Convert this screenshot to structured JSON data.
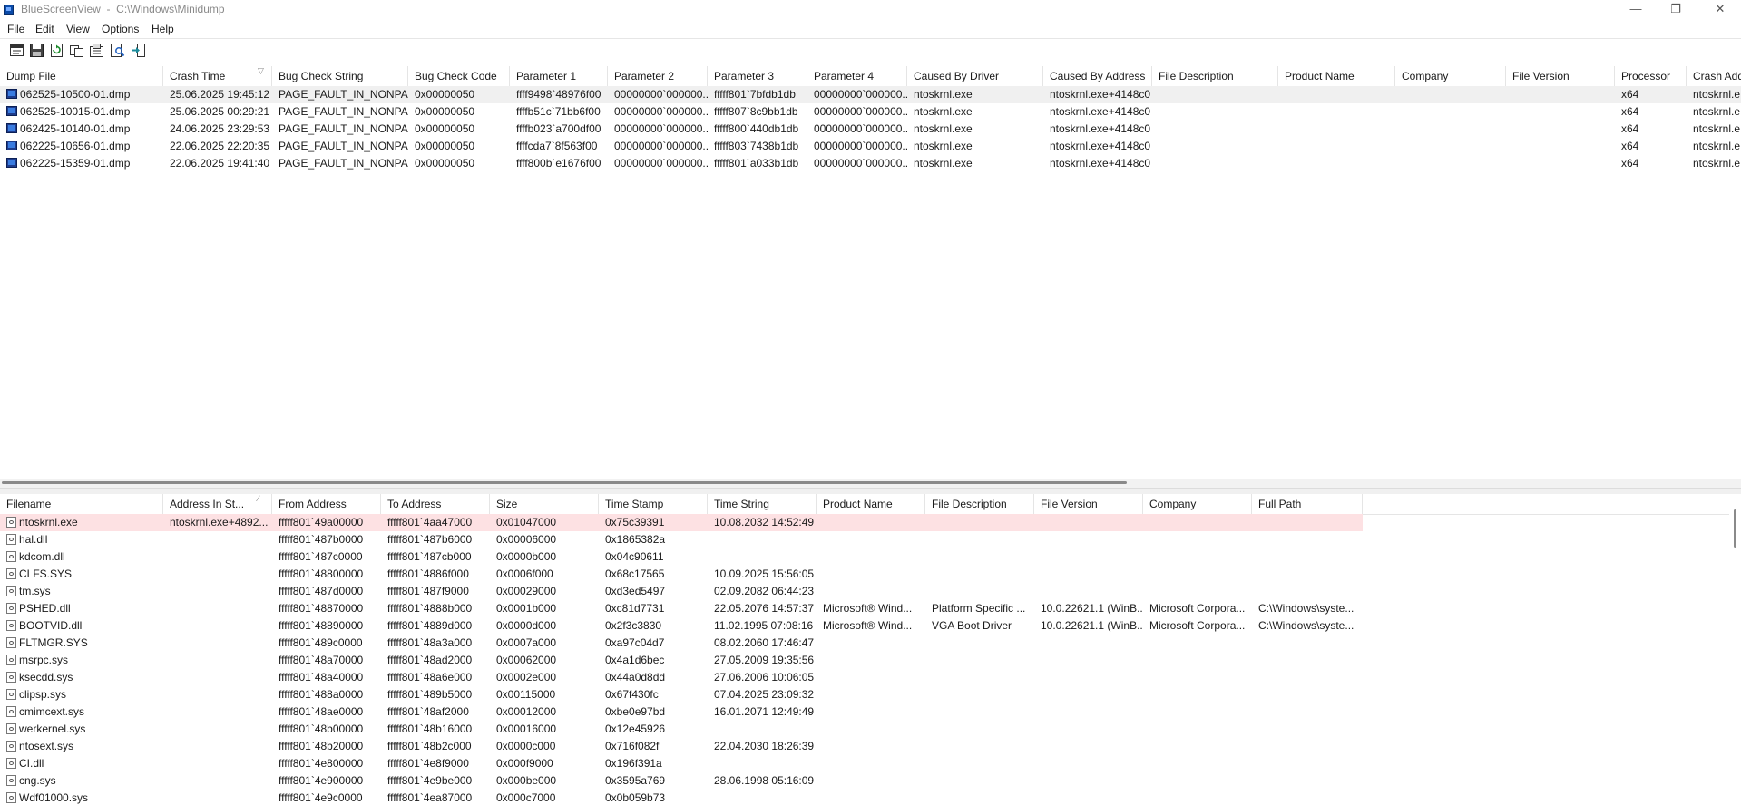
{
  "window": {
    "title": "BlueScreenView  -  C:\\Windows\\Minidump",
    "min_icon": "minimize-icon",
    "max_icon": "maximize-icon",
    "close_icon": "close-icon"
  },
  "menu": [
    "File",
    "Edit",
    "View",
    "Options",
    "Help"
  ],
  "toolbar": {
    "buttons": [
      "html-report-icon",
      "save-icon",
      "refresh-icon",
      "copy-icon",
      "properties-icon",
      "find-icon",
      "exit-icon"
    ]
  },
  "crashes": {
    "columns": [
      "Dump File",
      "Crash Time",
      "Bug Check String",
      "Bug Check Code",
      "Parameter 1",
      "Parameter 2",
      "Parameter 3",
      "Parameter 4",
      "Caused By Driver",
      "Caused By Address",
      "File Description",
      "Product Name",
      "Company",
      "File Version",
      "Processor",
      "Crash Add"
    ],
    "sort_column": "Crash Time",
    "rows": [
      [
        "062525-10500-01.dmp",
        "25.06.2025 19:45:12",
        "PAGE_FAULT_IN_NONPA...",
        "0x00000050",
        "ffff9498`48976f00",
        "00000000`000000...",
        "fffff801`7bfdb1db",
        "00000000`000000...",
        "ntoskrnl.exe",
        "ntoskrnl.exe+4148c0",
        "",
        "",
        "",
        "",
        "x64",
        "ntoskrnl.e"
      ],
      [
        "062525-10015-01.dmp",
        "25.06.2025 00:29:21",
        "PAGE_FAULT_IN_NONPA...",
        "0x00000050",
        "ffffb51c`71bb6f00",
        "00000000`000000...",
        "fffff807`8c9bb1db",
        "00000000`000000...",
        "ntoskrnl.exe",
        "ntoskrnl.exe+4148c0",
        "",
        "",
        "",
        "",
        "x64",
        "ntoskrnl.e"
      ],
      [
        "062425-10140-01.dmp",
        "24.06.2025 23:29:53",
        "PAGE_FAULT_IN_NONPA...",
        "0x00000050",
        "ffffb023`a700df00",
        "00000000`000000...",
        "fffff800`440db1db",
        "00000000`000000...",
        "ntoskrnl.exe",
        "ntoskrnl.exe+4148c0",
        "",
        "",
        "",
        "",
        "x64",
        "ntoskrnl.e"
      ],
      [
        "062225-10656-01.dmp",
        "22.06.2025 22:20:35",
        "PAGE_FAULT_IN_NONPA...",
        "0x00000050",
        "ffffcda7`8f563f00",
        "00000000`000000...",
        "fffff803`7438b1db",
        "00000000`000000...",
        "ntoskrnl.exe",
        "ntoskrnl.exe+4148c0",
        "",
        "",
        "",
        "",
        "x64",
        "ntoskrnl.e"
      ],
      [
        "062225-15359-01.dmp",
        "22.06.2025 19:41:40",
        "PAGE_FAULT_IN_NONPA...",
        "0x00000050",
        "ffff800b`e1676f00",
        "00000000`000000...",
        "fffff801`a033b1db",
        "00000000`000000...",
        "ntoskrnl.exe",
        "ntoskrnl.exe+4148c0",
        "",
        "",
        "",
        "",
        "x64",
        "ntoskrnl.e"
      ]
    ]
  },
  "drivers": {
    "columns": [
      "Filename",
      "Address In St...",
      "From Address",
      "To Address",
      "Size",
      "Time Stamp",
      "Time String",
      "Product Name",
      "File Description",
      "File Version",
      "Company",
      "Full Path"
    ],
    "sort_column": "Address In St...",
    "rows": [
      [
        "ntoskrnl.exe",
        "ntoskrnl.exe+4892...",
        "fffff801`49a00000",
        "fffff801`4aa47000",
        "0x01047000",
        "0x75c39391",
        "10.08.2032 14:52:49",
        "",
        "",
        "",
        "",
        ""
      ],
      [
        "hal.dll",
        "",
        "fffff801`487b0000",
        "fffff801`487b6000",
        "0x00006000",
        "0x1865382a",
        "",
        "",
        "",
        "",
        "",
        ""
      ],
      [
        "kdcom.dll",
        "",
        "fffff801`487c0000",
        "fffff801`487cb000",
        "0x0000b000",
        "0x04c90611",
        "",
        "",
        "",
        "",
        "",
        ""
      ],
      [
        "CLFS.SYS",
        "",
        "fffff801`48800000",
        "fffff801`4886f000",
        "0x0006f000",
        "0x68c17565",
        "10.09.2025 15:56:05",
        "",
        "",
        "",
        "",
        ""
      ],
      [
        "tm.sys",
        "",
        "fffff801`487d0000",
        "fffff801`487f9000",
        "0x00029000",
        "0xd3ed5497",
        "02.09.2082 06:44:23",
        "",
        "",
        "",
        "",
        ""
      ],
      [
        "PSHED.dll",
        "",
        "fffff801`48870000",
        "fffff801`4888b000",
        "0x0001b000",
        "0xc81d7731",
        "22.05.2076 14:57:37",
        "Microsoft® Wind...",
        "Platform Specific ...",
        "10.0.22621.1 (WinB...",
        "Microsoft Corpora...",
        "C:\\Windows\\syste..."
      ],
      [
        "BOOTVID.dll",
        "",
        "fffff801`48890000",
        "fffff801`4889d000",
        "0x0000d000",
        "0x2f3c3830",
        "11.02.1995 07:08:16",
        "Microsoft® Wind...",
        "VGA Boot Driver",
        "10.0.22621.1 (WinB...",
        "Microsoft Corpora...",
        "C:\\Windows\\syste..."
      ],
      [
        "FLTMGR.SYS",
        "",
        "fffff801`489c0000",
        "fffff801`48a3a000",
        "0x0007a000",
        "0xa97c04d7",
        "08.02.2060 17:46:47",
        "",
        "",
        "",
        "",
        ""
      ],
      [
        "msrpc.sys",
        "",
        "fffff801`48a70000",
        "fffff801`48ad2000",
        "0x00062000",
        "0x4a1d6bec",
        "27.05.2009 19:35:56",
        "",
        "",
        "",
        "",
        ""
      ],
      [
        "ksecdd.sys",
        "",
        "fffff801`48a40000",
        "fffff801`48a6e000",
        "0x0002e000",
        "0x44a0d8dd",
        "27.06.2006 10:06:05",
        "",
        "",
        "",
        "",
        ""
      ],
      [
        "clipsp.sys",
        "",
        "fffff801`488a0000",
        "fffff801`489b5000",
        "0x00115000",
        "0x67f430fc",
        "07.04.2025 23:09:32",
        "",
        "",
        "",
        "",
        ""
      ],
      [
        "cmimcext.sys",
        "",
        "fffff801`48ae0000",
        "fffff801`48af2000",
        "0x00012000",
        "0xbe0e97bd",
        "16.01.2071 12:49:49",
        "",
        "",
        "",
        "",
        ""
      ],
      [
        "werkernel.sys",
        "",
        "fffff801`48b00000",
        "fffff801`48b16000",
        "0x00016000",
        "0x12e45926",
        "",
        "",
        "",
        "",
        "",
        ""
      ],
      [
        "ntosext.sys",
        "",
        "fffff801`48b20000",
        "fffff801`48b2c000",
        "0x0000c000",
        "0x716f082f",
        "22.04.2030 18:26:39",
        "",
        "",
        "",
        "",
        ""
      ],
      [
        "CI.dll",
        "",
        "fffff801`4e800000",
        "fffff801`4e8f9000",
        "0x000f9000",
        "0x196f391a",
        "",
        "",
        "",
        "",
        "",
        ""
      ],
      [
        "cng.sys",
        "",
        "fffff801`4e900000",
        "fffff801`4e9be000",
        "0x000be000",
        "0x3595a769",
        "28.06.1998 05:16:09",
        "",
        "",
        "",
        "",
        ""
      ],
      [
        "Wdf01000.sys",
        "",
        "fffff801`4e9c0000",
        "fffff801`4ea87000",
        "0x000c7000",
        "0x0b059b73",
        "",
        "",
        "",
        "",
        "",
        ""
      ]
    ]
  }
}
